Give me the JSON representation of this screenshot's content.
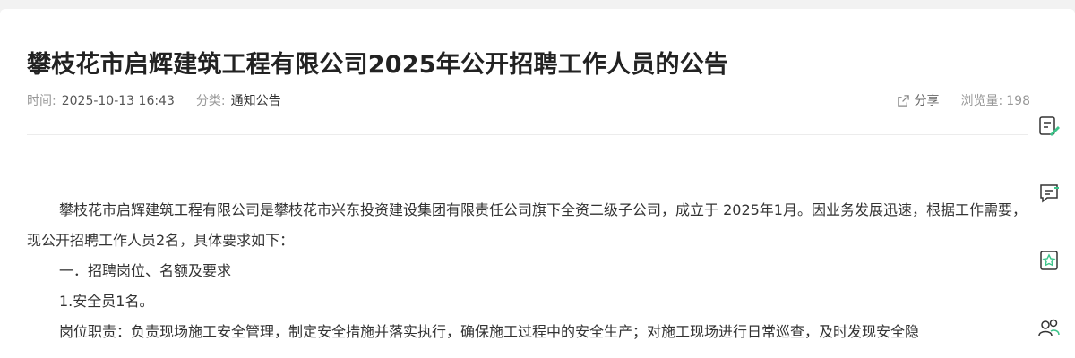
{
  "article": {
    "title": "攀枝花市启辉建筑工程有限公司2025年公开招聘工作人员的公告",
    "meta": {
      "time_label": "时间:",
      "time": "2025-10-13 16:43",
      "category_label": "分类:",
      "category": "通知公告",
      "share_label": "分享",
      "views_label": "浏览量:",
      "views": "198"
    },
    "paragraphs": {
      "p1": "攀枝花市启辉建筑工程有限公司是攀枝花市兴东投资建设集团有限责任公司旗下全资二级子公司，成立于 2025年1月。因业务发展迅速，根据工作需要，现公开招聘工作人员2名，具体要求如下：",
      "p2": "一．招聘岗位、名额及要求",
      "p3": "1.安全员1名。",
      "p4": "岗位职责：负责现场施工安全管理，制定安全措施并落实执行，确保施工过程中的安全生产；对施工现场进行日常巡查，及时发现安全隐"
    }
  },
  "side_toolbar": {
    "icons": [
      "edit-note-icon",
      "message-icon",
      "favorite-star-icon",
      "user-group-icon"
    ]
  },
  "colors": {
    "background": "#f2f2f2",
    "card": "#ffffff",
    "accent": "#3cc48a",
    "title": "#222222",
    "muted": "#999999"
  }
}
